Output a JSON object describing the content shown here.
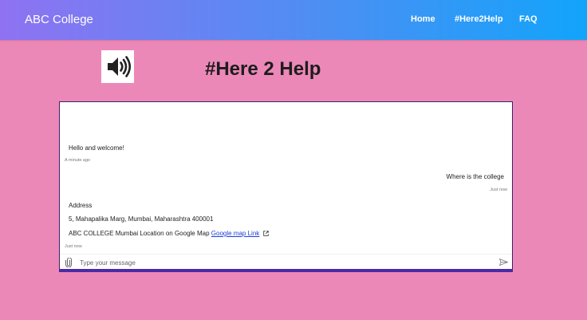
{
  "navbar": {
    "brand": "ABC College",
    "links": [
      "Home",
      "#Here2Help",
      "FAQ"
    ]
  },
  "hero": {
    "title": "#Here 2 Help",
    "icon": "speaker-icon"
  },
  "chat": {
    "messages": [
      {
        "from": "bot",
        "lines": [
          "Hello and welcome!"
        ],
        "time": "A minute ago"
      },
      {
        "from": "user",
        "lines": [
          "Where is the college"
        ],
        "time": "Just now"
      },
      {
        "from": "bot",
        "lines": [
          "Address",
          "5, Mahapalika Marg, Mumbai, Maharashtra 400001",
          "ABC COLLEGE Mumbai Location on Google Map"
        ],
        "link_text": "Google map Link",
        "time": "Just now"
      }
    ],
    "input_placeholder": "Type your message",
    "attach_icon": "paperclip-icon",
    "send_icon": "send-icon"
  },
  "colors": {
    "background": "#ec88b8",
    "nav_gradient_start": "#8f72f2",
    "nav_gradient_end": "#12a4fb",
    "accent": "#4b2aa8",
    "link": "#1b3fd8"
  }
}
